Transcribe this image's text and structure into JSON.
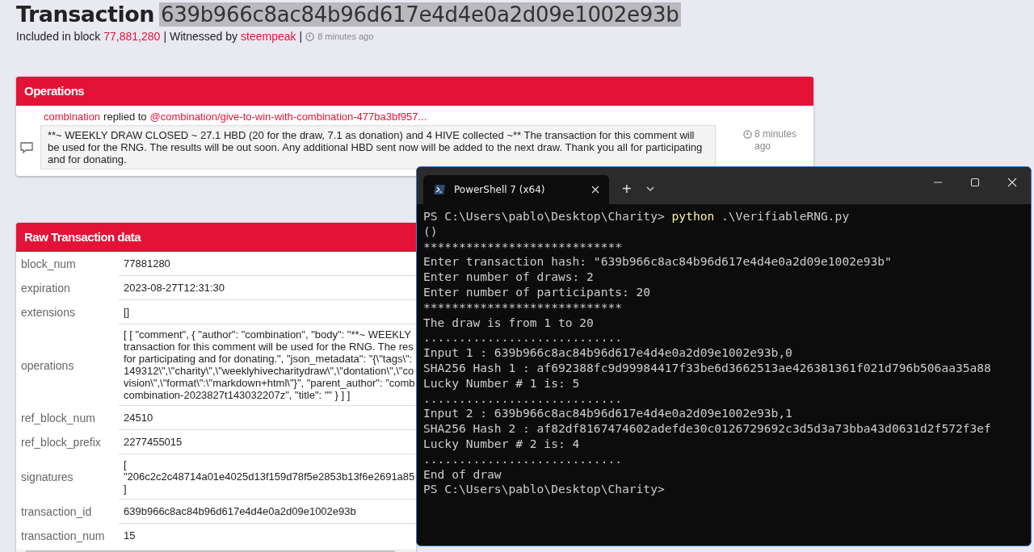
{
  "header": {
    "title": "Transaction",
    "tx_hash": "639b966c8ac84b96d617e4d4e0a2d09e1002e93b",
    "block_label": "Included in block",
    "block": "77,881,280",
    "separators": [
      "|",
      "|"
    ],
    "witness_label": "Witnessed by",
    "witness": "steempeak",
    "time": "8 minutes ago"
  },
  "operations": {
    "title": "Operations",
    "items": [
      {
        "author": "combination",
        "action": "replied to",
        "target": "@combination/give-to-win-with-combination-477ba3bf957...",
        "body": "**~ WEEKLY DRAW CLOSED ~ 27.1 HBD (20 for the draw, 7.1 as donation) and 4 HIVE collected ~** The transaction for this comment will be used for the RNG. The results will be out soon. Any additional HBD sent now will be added to the next draw. Thank you all for participating and for donating.",
        "time": "8 minutes ago"
      }
    ]
  },
  "raw": {
    "title": "Raw Transaction data",
    "rows": [
      {
        "key": "block_num",
        "lines": [
          "77881280"
        ]
      },
      {
        "key": "expiration",
        "lines": [
          "2023-08-27T12:31:30"
        ]
      },
      {
        "key": "extensions",
        "lines": [
          "[]"
        ]
      },
      {
        "key": "operations",
        "lines": [
          "[ [ \"comment\", { \"author\": \"combination\", \"body\": \"**~ WEEKLY",
          "transaction for this comment will be used for the RNG. The res",
          "for participating and for donating.\", \"json_metadata\": \"{\\\"tags\\\":",
          "149312\\\",\\\"charity\\\",\\\"weeklyhivecharitydraw\\\",\\\"dontation\\\",\\\"co",
          "vision\\\",\\\"format\\\":\\\"markdown+html\\\"}\", \"parent_author\": \"comb",
          "combination-2023827t143032207z\", \"title\": \"\" } ] ]"
        ]
      },
      {
        "key": "ref_block_num",
        "lines": [
          "24510"
        ]
      },
      {
        "key": "ref_block_prefix",
        "lines": [
          "2277455015"
        ]
      },
      {
        "key": "signatures",
        "lines": [
          "[",
          "\"206c2c2c48714a01e4025d13f159d78f5e2853b13f6e2691a85",
          "]"
        ]
      },
      {
        "key": "transaction_id",
        "lines": [
          "639b966c8ac84b96d617e4d4e0a2d09e1002e93b"
        ]
      },
      {
        "key": "transaction_num",
        "lines": [
          "15"
        ]
      }
    ]
  },
  "terminal": {
    "tab_title": "PowerShell 7 (x64)",
    "new_tab": "+",
    "lines": [
      {
        "kind": "command",
        "prompt": "PS C:\\Users\\pablo\\Desktop\\Charity>",
        "command": "python",
        "args": ".\\VerifiableRNG.py"
      },
      {
        "kind": "output",
        "text": "()"
      },
      {
        "kind": "output",
        "text": "****************************"
      },
      {
        "kind": "output",
        "text": "Enter transaction hash: \"639b966c8ac84b96d617e4d4e0a2d09e1002e93b\""
      },
      {
        "kind": "output",
        "text": "Enter number of draws: 2"
      },
      {
        "kind": "output",
        "text": "Enter number of participants: 20"
      },
      {
        "kind": "output",
        "text": "****************************"
      },
      {
        "kind": "output",
        "text": "The draw is from 1 to 20"
      },
      {
        "kind": "output",
        "text": "............................"
      },
      {
        "kind": "output",
        "text": "Input 1 : 639b966c8ac84b96d617e4d4e0a2d09e1002e93b,0"
      },
      {
        "kind": "output",
        "text": "SHA256 Hash 1 : af692388fc9d99984417f33be6d3662513ae426381361f021d796b506aa35a88"
      },
      {
        "kind": "output",
        "text": "Lucky Number # 1 is: 5"
      },
      {
        "kind": "output",
        "text": "............................"
      },
      {
        "kind": "output",
        "text": "Input 2 : 639b966c8ac84b96d617e4d4e0a2d09e1002e93b,1"
      },
      {
        "kind": "output",
        "text": "SHA256 Hash 2 : af82df8167474602adefde30c0126729692c3d5d3a73bba43d0631d2f572f3ef"
      },
      {
        "kind": "output",
        "text": "Lucky Number # 2 is: 4"
      },
      {
        "kind": "output",
        "text": "............................"
      },
      {
        "kind": "output",
        "text": "End of draw"
      },
      {
        "kind": "prompt",
        "text": "PS C:\\Users\\pablo\\Desktop\\Charity>"
      }
    ]
  }
}
